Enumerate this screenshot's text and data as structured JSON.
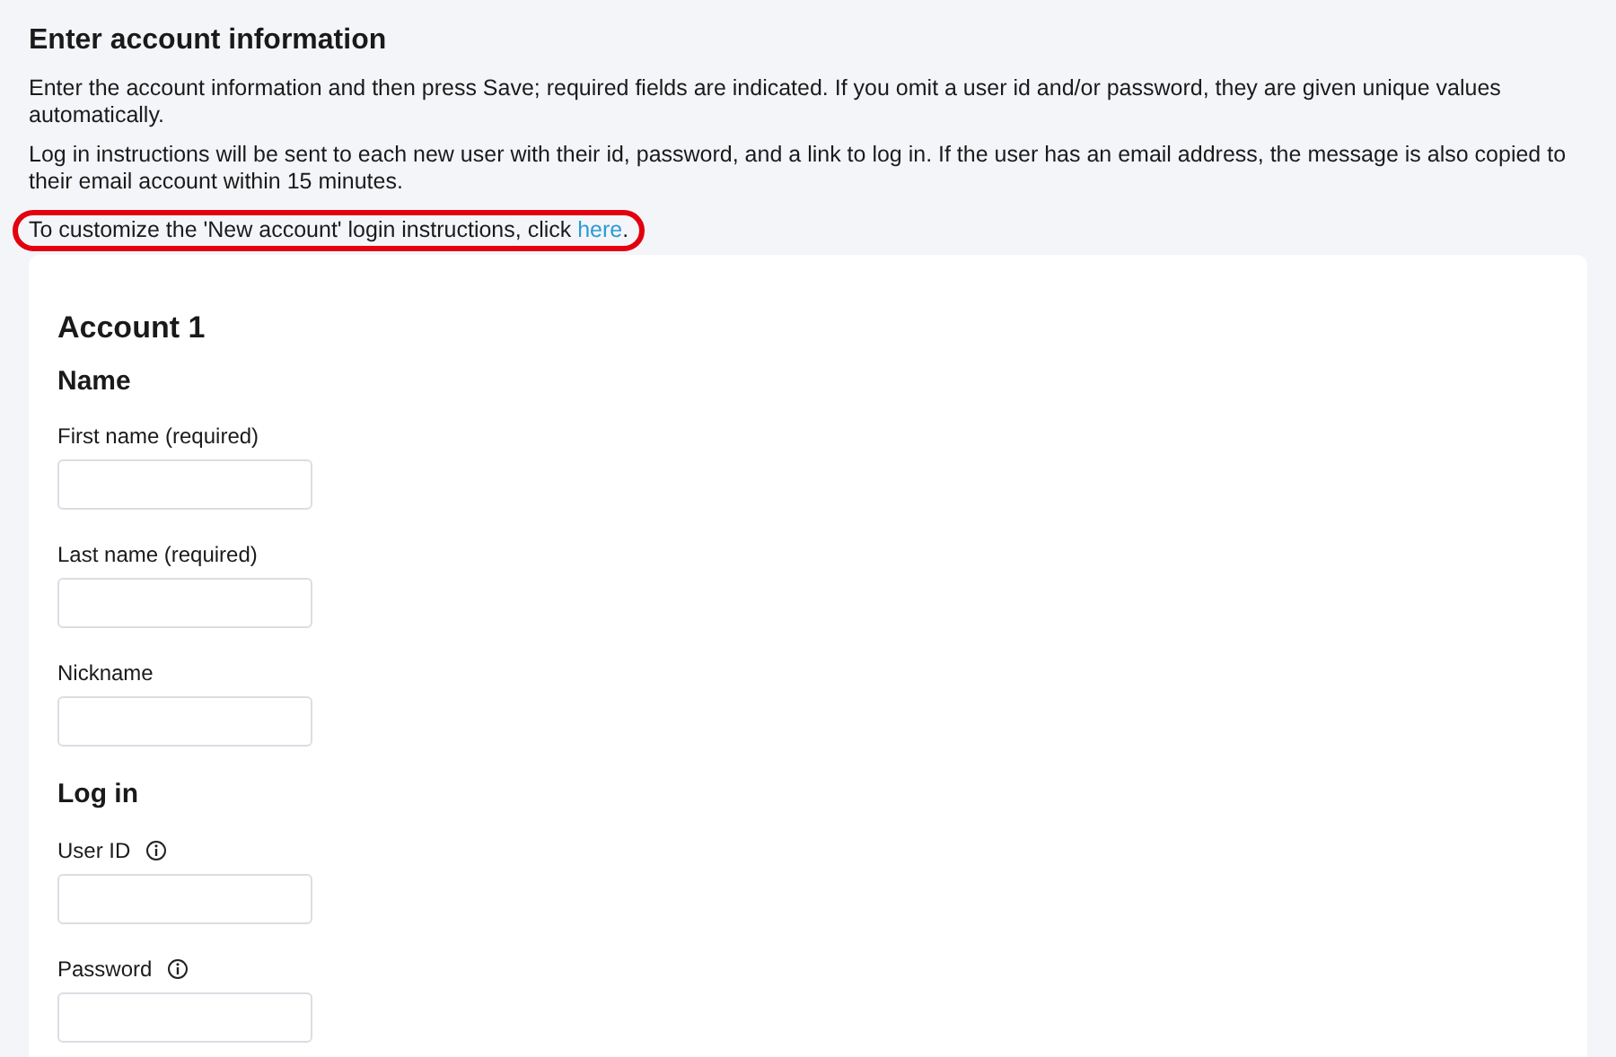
{
  "heading": "Enter account information",
  "paragraphs": [
    {
      "text": "Enter the account information and then press Save; required fields are indicated. If you omit a user id and/or password, they are given unique values automatically.",
      "circled": false
    },
    {
      "text": "Log in instructions will be sent to each new user with their id, password, and a link to log in. If the user has an email address, the message is also copied to their email account within 15 minutes.",
      "circled": false
    },
    {
      "text": "To customize the 'New account' login instructions, click ",
      "link": "here",
      "after": ".",
      "circled": true
    }
  ],
  "account": {
    "title": "Account 1",
    "sections": [
      {
        "title": "Name",
        "fields": [
          {
            "label": "First name (required)",
            "info": false
          },
          {
            "label": "Last name (required)",
            "info": false
          },
          {
            "label": "Nickname",
            "info": false
          }
        ]
      },
      {
        "title": "Log in",
        "fields": [
          {
            "label": "User ID",
            "info": true
          },
          {
            "label": "Password",
            "info": true
          }
        ]
      }
    ]
  }
}
